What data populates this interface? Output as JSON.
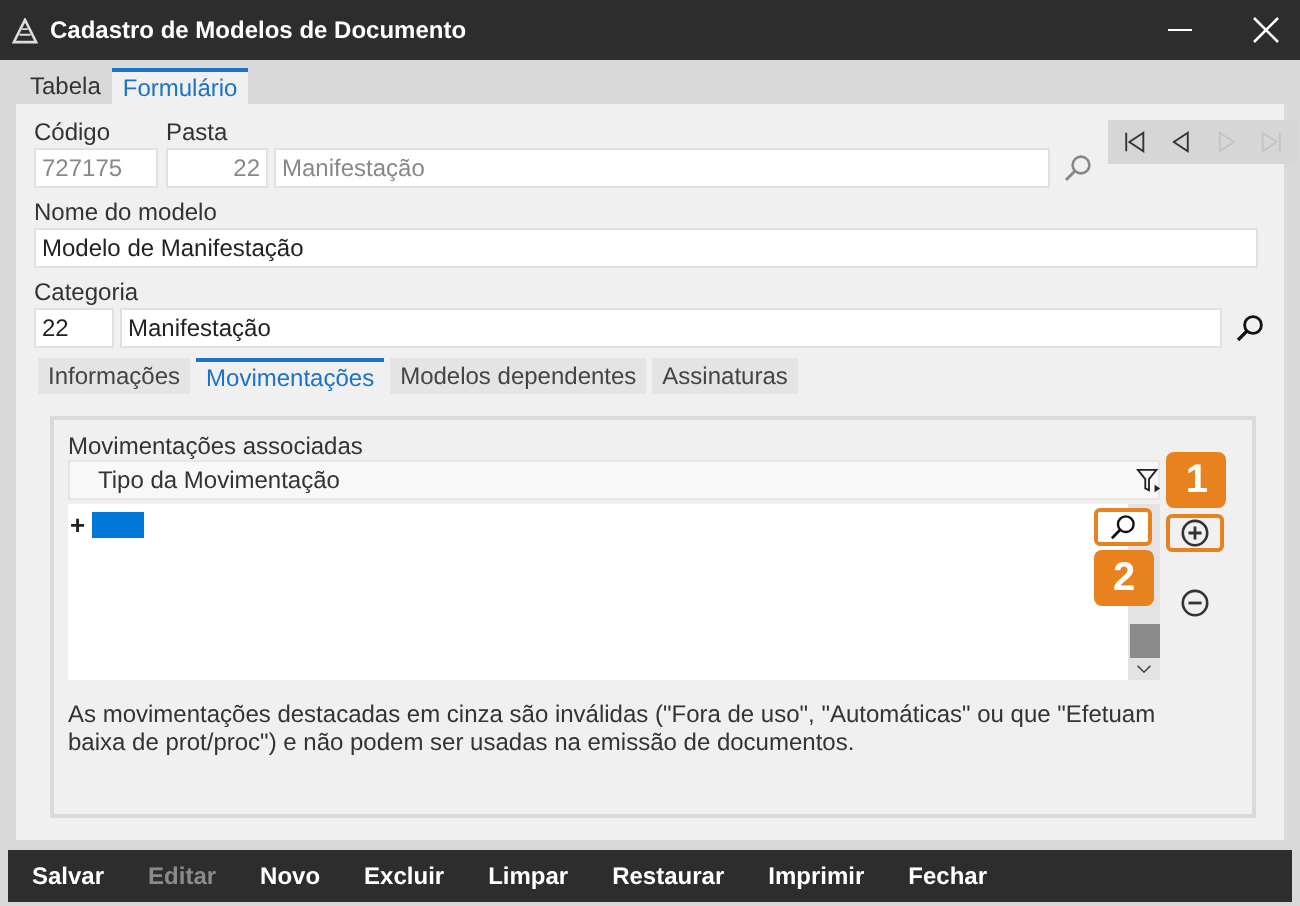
{
  "window": {
    "title": "Cadastro de Modelos de Documento"
  },
  "tabs": [
    {
      "label": "Tabela",
      "selected": false
    },
    {
      "label": "Formulário",
      "selected": true
    }
  ],
  "form": {
    "codigo": {
      "label": "Código",
      "value": "727175"
    },
    "pasta": {
      "label": "Pasta",
      "number": "22",
      "name": "Manifestação"
    },
    "nome": {
      "label": "Nome do modelo",
      "value": "Modelo de Manifestação"
    },
    "categoria": {
      "label": "Categoria",
      "number": "22",
      "name": "Manifestação"
    }
  },
  "nav_buttons": [
    {
      "kind": "first",
      "disabled": false
    },
    {
      "kind": "prev",
      "disabled": false
    },
    {
      "kind": "next",
      "disabled": true
    },
    {
      "kind": "last",
      "disabled": true
    }
  ],
  "subtabs": [
    {
      "label": "Informações",
      "selected": false
    },
    {
      "label": "Movimentações",
      "selected": true
    },
    {
      "label": "Modelos dependentes",
      "selected": false
    },
    {
      "label": "Assinaturas",
      "selected": false
    }
  ],
  "group": {
    "title": "Movimentações associadas",
    "column": "Tipo da Movimentação",
    "expander": "+",
    "callouts": [
      "1",
      "2"
    ],
    "note": "As movimentações destacadas em cinza são inválidas (\"Fora de uso\", \"Automáticas\" ou que \"Efetuam baixa de prot/proc\") e não podem ser usadas na emissão de documentos."
  },
  "actions": [
    {
      "label": "Salvar",
      "disabled": false
    },
    {
      "label": "Editar",
      "disabled": true
    },
    {
      "label": "Novo",
      "disabled": false
    },
    {
      "label": "Excluir",
      "disabled": false
    },
    {
      "label": "Limpar",
      "disabled": false
    },
    {
      "label": "Restaurar",
      "disabled": false
    },
    {
      "label": "Imprimir",
      "disabled": false
    },
    {
      "label": "Fechar",
      "disabled": false
    }
  ]
}
